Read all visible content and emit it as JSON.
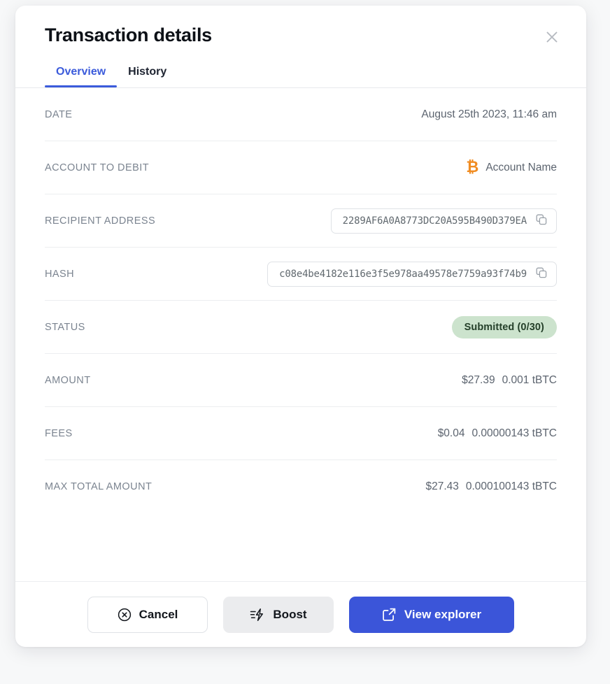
{
  "modal": {
    "title": "Transaction details",
    "close_icon": "close-icon"
  },
  "tabs": [
    {
      "label": "Overview",
      "active": true
    },
    {
      "label": "History",
      "active": false
    }
  ],
  "details": {
    "date": {
      "label": "DATE",
      "value": "August 25th 2023, 11:46 am"
    },
    "account": {
      "label": "ACCOUNT TO DEBIT",
      "icon": "bitcoin-icon",
      "symbol": "₿",
      "value": "Account Name"
    },
    "recipient": {
      "label": "RECIPIENT ADDRESS",
      "value": "2289AF6A0A8773DC20A595B490D379EA",
      "copy_icon": "copy-icon"
    },
    "hash": {
      "label": "HASH",
      "value": "c08e4be4182e116e3f5e978aa49578e7759a93f74b9",
      "copy_icon": "copy-icon"
    },
    "status": {
      "label": "STATUS",
      "value": "Submitted (0/30)",
      "badge_bg": "#cce3cd",
      "badge_color": "#25402a"
    },
    "amount": {
      "label": "AMOUNT",
      "fiat": "$27.39",
      "crypto": "0.001 tBTC"
    },
    "fees": {
      "label": "FEES",
      "fiat": "$0.04",
      "crypto": "0.00000143 tBTC"
    },
    "max_total": {
      "label": "MAX TOTAL AMOUNT",
      "fiat": "$27.43",
      "crypto": "0.000100143 tBTC"
    }
  },
  "footer": {
    "cancel": {
      "label": "Cancel",
      "icon": "cancel-circle-icon"
    },
    "boost": {
      "label": "Boost",
      "icon": "boost-icon"
    },
    "explorer": {
      "label": "View explorer",
      "icon": "external-link-icon"
    }
  },
  "colors": {
    "accent_blue": "#3b55d9",
    "tab_active": "#3b5bdb",
    "bitcoin_orange": "#f08c22",
    "status_green_bg": "#cce3cd"
  }
}
